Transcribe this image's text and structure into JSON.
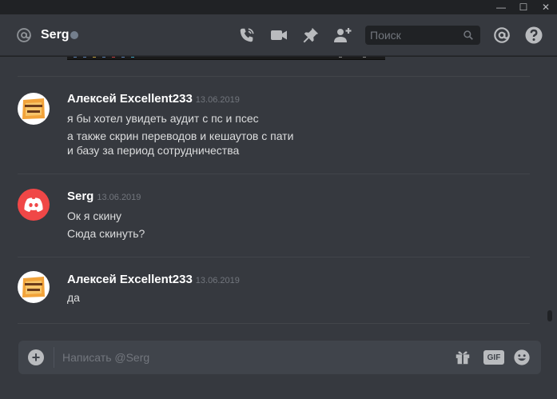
{
  "window": {
    "minimize": "—",
    "maximize": "☐",
    "close": "✕"
  },
  "header": {
    "channel_name": "Serg",
    "search_placeholder": "Поиск",
    "icons": [
      "at-icon",
      "phone-call-icon",
      "video-call-icon",
      "pin-icon",
      "add-friend-icon",
      "search-icon",
      "mentions-icon",
      "help-icon"
    ]
  },
  "messages": [
    {
      "author": "Алексей Excellent233",
      "timestamp": "13.06.2019",
      "lines": [
        "я бы хотел увидеть аудит с пс и псес",
        "а также скрин переводов и кешаутов с пати",
        "и базу за период сотрудничества"
      ]
    },
    {
      "author": "Serg",
      "timestamp": "13.06.2019",
      "lines": [
        "Ок я скину",
        "Сюда скинуть?"
      ]
    },
    {
      "author": "Алексей Excellent233",
      "timestamp": "13.06.2019",
      "lines": [
        "да"
      ]
    }
  ],
  "composer": {
    "plus": "+",
    "placeholder": "Написать @Serg",
    "gif_label": "GIF"
  },
  "colors": {
    "background": "#36393f",
    "titlebar": "#202225",
    "accent_red": "#f04747",
    "text": "#dcddde",
    "muted": "#72767d"
  }
}
